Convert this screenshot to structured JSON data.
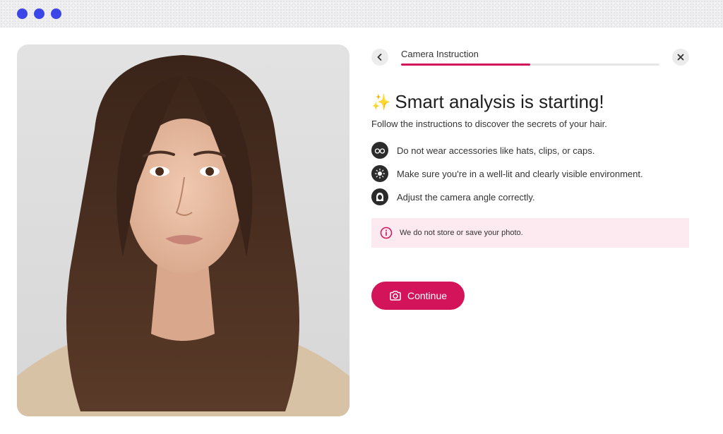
{
  "window": {
    "traffic_dots": 3,
    "accent": "#3b46e8"
  },
  "photo": {
    "alt": "portrait-photo"
  },
  "header": {
    "title": "Camera Instruction",
    "progress_percent": 50,
    "back_icon": "chevron-left-icon",
    "close_icon": "close-icon"
  },
  "main": {
    "headline": "Smart analysis is starting!",
    "sparkle": "✨",
    "subtitle": "Follow the instructions to discover the secrets of your hair.",
    "instructions": [
      {
        "icon": "glasses-icon",
        "text": "Do not wear accessories like hats, clips, or caps."
      },
      {
        "icon": "sun-icon",
        "text": "Make sure you're in a well-lit and clearly visible environment."
      },
      {
        "icon": "face-icon",
        "text": "Adjust the camera angle correctly."
      }
    ],
    "notice": {
      "icon": "info-icon",
      "text": "We do not store or save your photo."
    },
    "continue_label": "Continue"
  },
  "colors": {
    "brand": "#d4145a",
    "notice_bg": "#fde9f0"
  }
}
